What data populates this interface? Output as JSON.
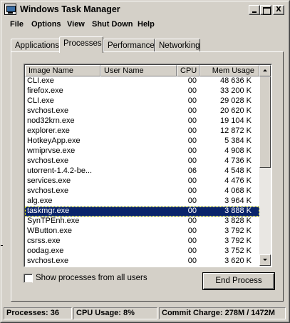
{
  "window": {
    "title": "Windows Task Manager"
  },
  "caption_buttons": {
    "minimize": "_",
    "maximize": "□",
    "close": "X"
  },
  "menu": [
    {
      "label": "File"
    },
    {
      "label": "Options"
    },
    {
      "label": "View"
    },
    {
      "label": "Shut Down"
    },
    {
      "label": "Help"
    }
  ],
  "tabs": [
    {
      "label": "Applications"
    },
    {
      "label": "Processes"
    },
    {
      "label": "Performance"
    },
    {
      "label": "Networking"
    }
  ],
  "active_tab": "Processes",
  "process_list": {
    "columns": [
      "Image Name",
      "User Name",
      "CPU",
      "Mem Usage"
    ],
    "rows": [
      {
        "name": "CLI.exe",
        "user": "",
        "cpu": "00",
        "mem": "48 636 K"
      },
      {
        "name": "firefox.exe",
        "user": "",
        "cpu": "00",
        "mem": "33 200 K"
      },
      {
        "name": "CLI.exe",
        "user": "",
        "cpu": "00",
        "mem": "29 028 K"
      },
      {
        "name": "svchost.exe",
        "user": "",
        "cpu": "00",
        "mem": "20 620 K"
      },
      {
        "name": "nod32krn.exe",
        "user": "",
        "cpu": "00",
        "mem": "19 104 K"
      },
      {
        "name": "explorer.exe",
        "user": "",
        "cpu": "00",
        "mem": "12 872 K"
      },
      {
        "name": "HotkeyApp.exe",
        "user": "",
        "cpu": "00",
        "mem": "5 384 K"
      },
      {
        "name": "wmiprvse.exe",
        "user": "",
        "cpu": "00",
        "mem": "4 908 K"
      },
      {
        "name": "svchost.exe",
        "user": "",
        "cpu": "00",
        "mem": "4 736 K"
      },
      {
        "name": "utorrent-1.4.2-be...",
        "user": "",
        "cpu": "06",
        "mem": "4 548 K"
      },
      {
        "name": "services.exe",
        "user": "",
        "cpu": "00",
        "mem": "4 476 K"
      },
      {
        "name": "svchost.exe",
        "user": "",
        "cpu": "00",
        "mem": "4 068 K"
      },
      {
        "name": "alg.exe",
        "user": "",
        "cpu": "00",
        "mem": "3 964 K"
      },
      {
        "name": "taskmgr.exe",
        "user": "",
        "cpu": "00",
        "mem": "3 888 K",
        "selected": true
      },
      {
        "name": "SynTPEnh.exe",
        "user": "",
        "cpu": "00",
        "mem": "3 828 K"
      },
      {
        "name": "WButton.exe",
        "user": "",
        "cpu": "00",
        "mem": "3 792 K"
      },
      {
        "name": "csrss.exe",
        "user": "",
        "cpu": "00",
        "mem": "3 792 K"
      },
      {
        "name": "oodag.exe",
        "user": "",
        "cpu": "00",
        "mem": "3 752 K"
      },
      {
        "name": "svchost.exe",
        "user": "",
        "cpu": "00",
        "mem": "3 620 K"
      }
    ]
  },
  "show_all_processes": {
    "label": "Show processes from all users",
    "checked": false
  },
  "end_process_button": {
    "label": "End Process"
  },
  "status": {
    "processes": "Processes: 36",
    "cpu_usage": "CPU Usage: 8%",
    "commit_charge": "Commit Charge: 278M / 1472M"
  },
  "colors": {
    "face": "#d4d0c8",
    "selection": "#0a246a",
    "selection_text": "#ffffff"
  }
}
